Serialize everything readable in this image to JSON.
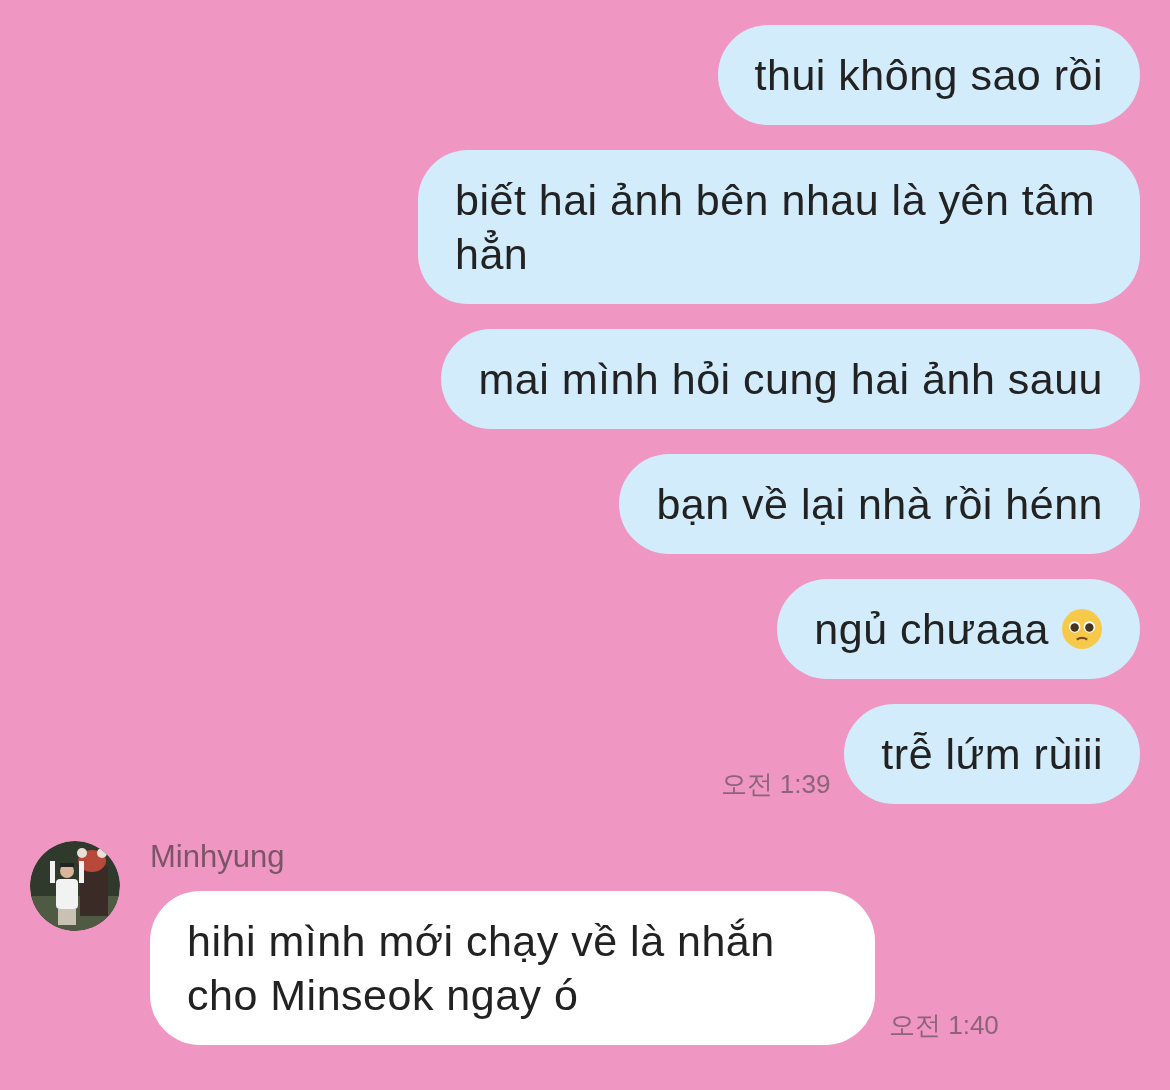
{
  "messages": [
    {
      "kind": "outgoing",
      "text": "thui không sao rồi"
    },
    {
      "kind": "outgoing",
      "text": "biết hai ảnh bên nhau là yên tâm hẳn"
    },
    {
      "kind": "outgoing",
      "text": "mai mình hỏi cung hai ảnh sauu"
    },
    {
      "kind": "outgoing",
      "text": "bạn về lại nhà rồi hénn"
    },
    {
      "kind": "outgoing",
      "text": "ngủ chưaaa",
      "emoji": true
    },
    {
      "kind": "outgoing",
      "text": "trễ lứm rùiii",
      "time": "오전 1:39"
    },
    {
      "kind": "incoming",
      "sender": "Minhyung",
      "text": "hihi mình mới chạy về là nhắn cho Minseok ngay ó",
      "time": "오전 1:40"
    }
  ]
}
